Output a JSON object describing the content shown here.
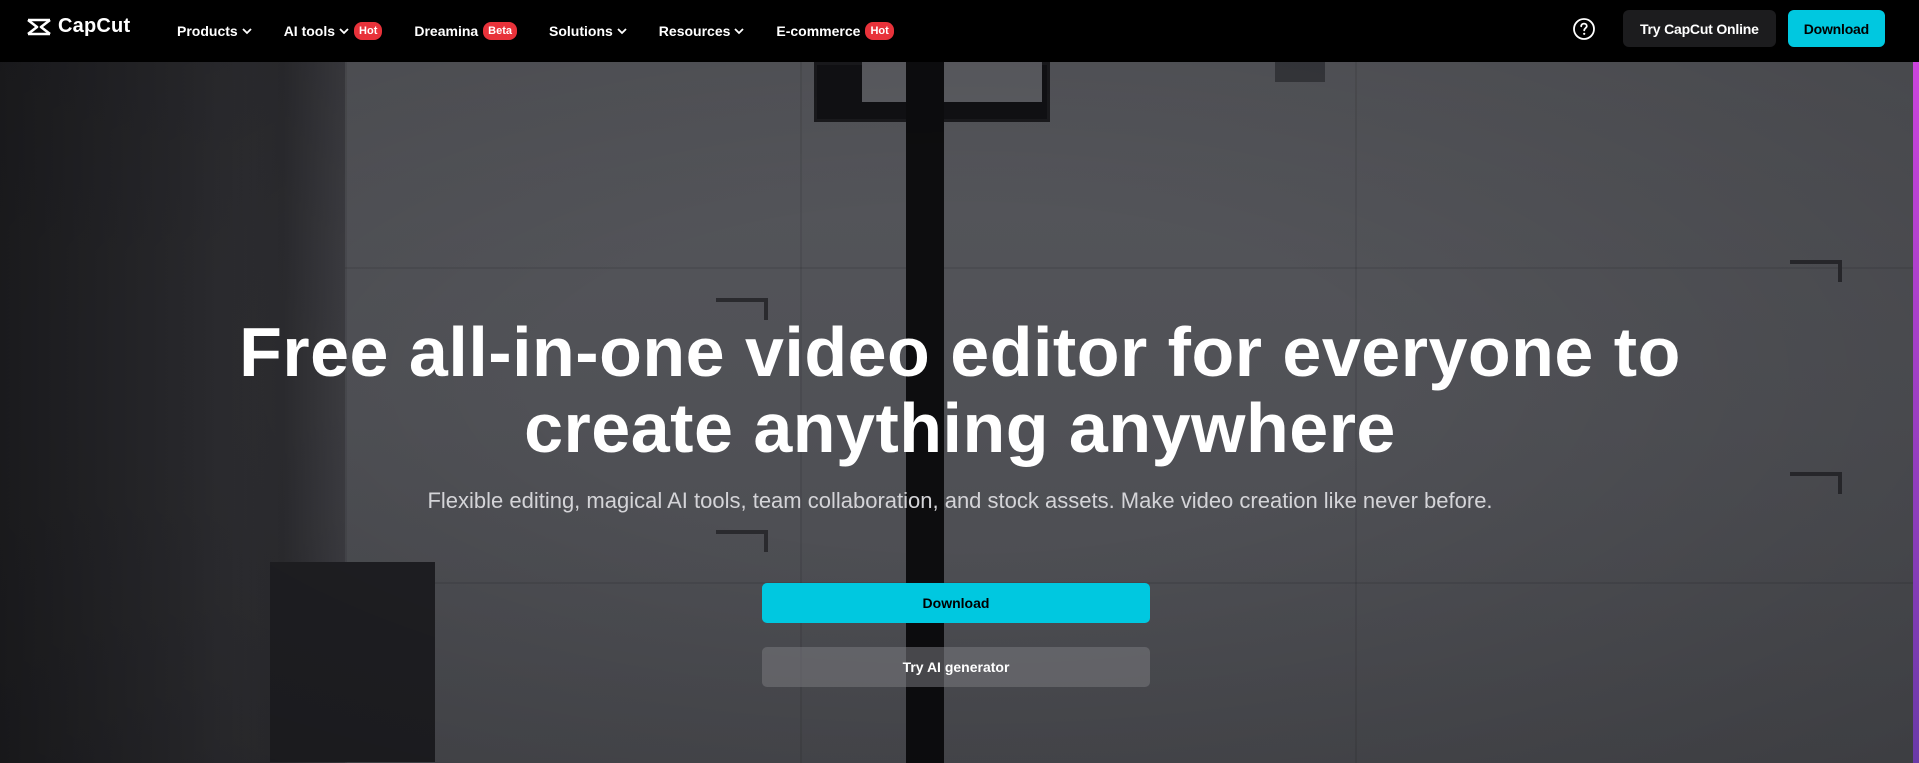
{
  "brand": {
    "name": "CapCut",
    "logo_icon": "capcut-logo-icon"
  },
  "nav": {
    "items": [
      {
        "label": "Products",
        "has_dropdown": true,
        "badge": ""
      },
      {
        "label": "AI tools",
        "has_dropdown": true,
        "badge": "Hot"
      },
      {
        "label": "Dreamina",
        "has_dropdown": false,
        "badge": "Beta"
      },
      {
        "label": "Solutions",
        "has_dropdown": true,
        "badge": ""
      },
      {
        "label": "Resources",
        "has_dropdown": true,
        "badge": ""
      },
      {
        "label": "E-commerce",
        "has_dropdown": false,
        "badge": "Hot"
      }
    ],
    "help_icon": "help-circle-icon",
    "try_online_label": "Try CapCut Online",
    "download_label": "Download"
  },
  "hero": {
    "headline": "Free all-in-one video editor for everyone to create anything anywhere",
    "subheadline": "Flexible editing, magical AI tools, team collaboration, and stock assets. Make video creation like never before.",
    "primary_button_label": "Download",
    "secondary_button_label": "Try AI generator"
  },
  "colors": {
    "accent": "#00c8e0",
    "badge": "#e8323a",
    "nav_bg": "#000000"
  }
}
